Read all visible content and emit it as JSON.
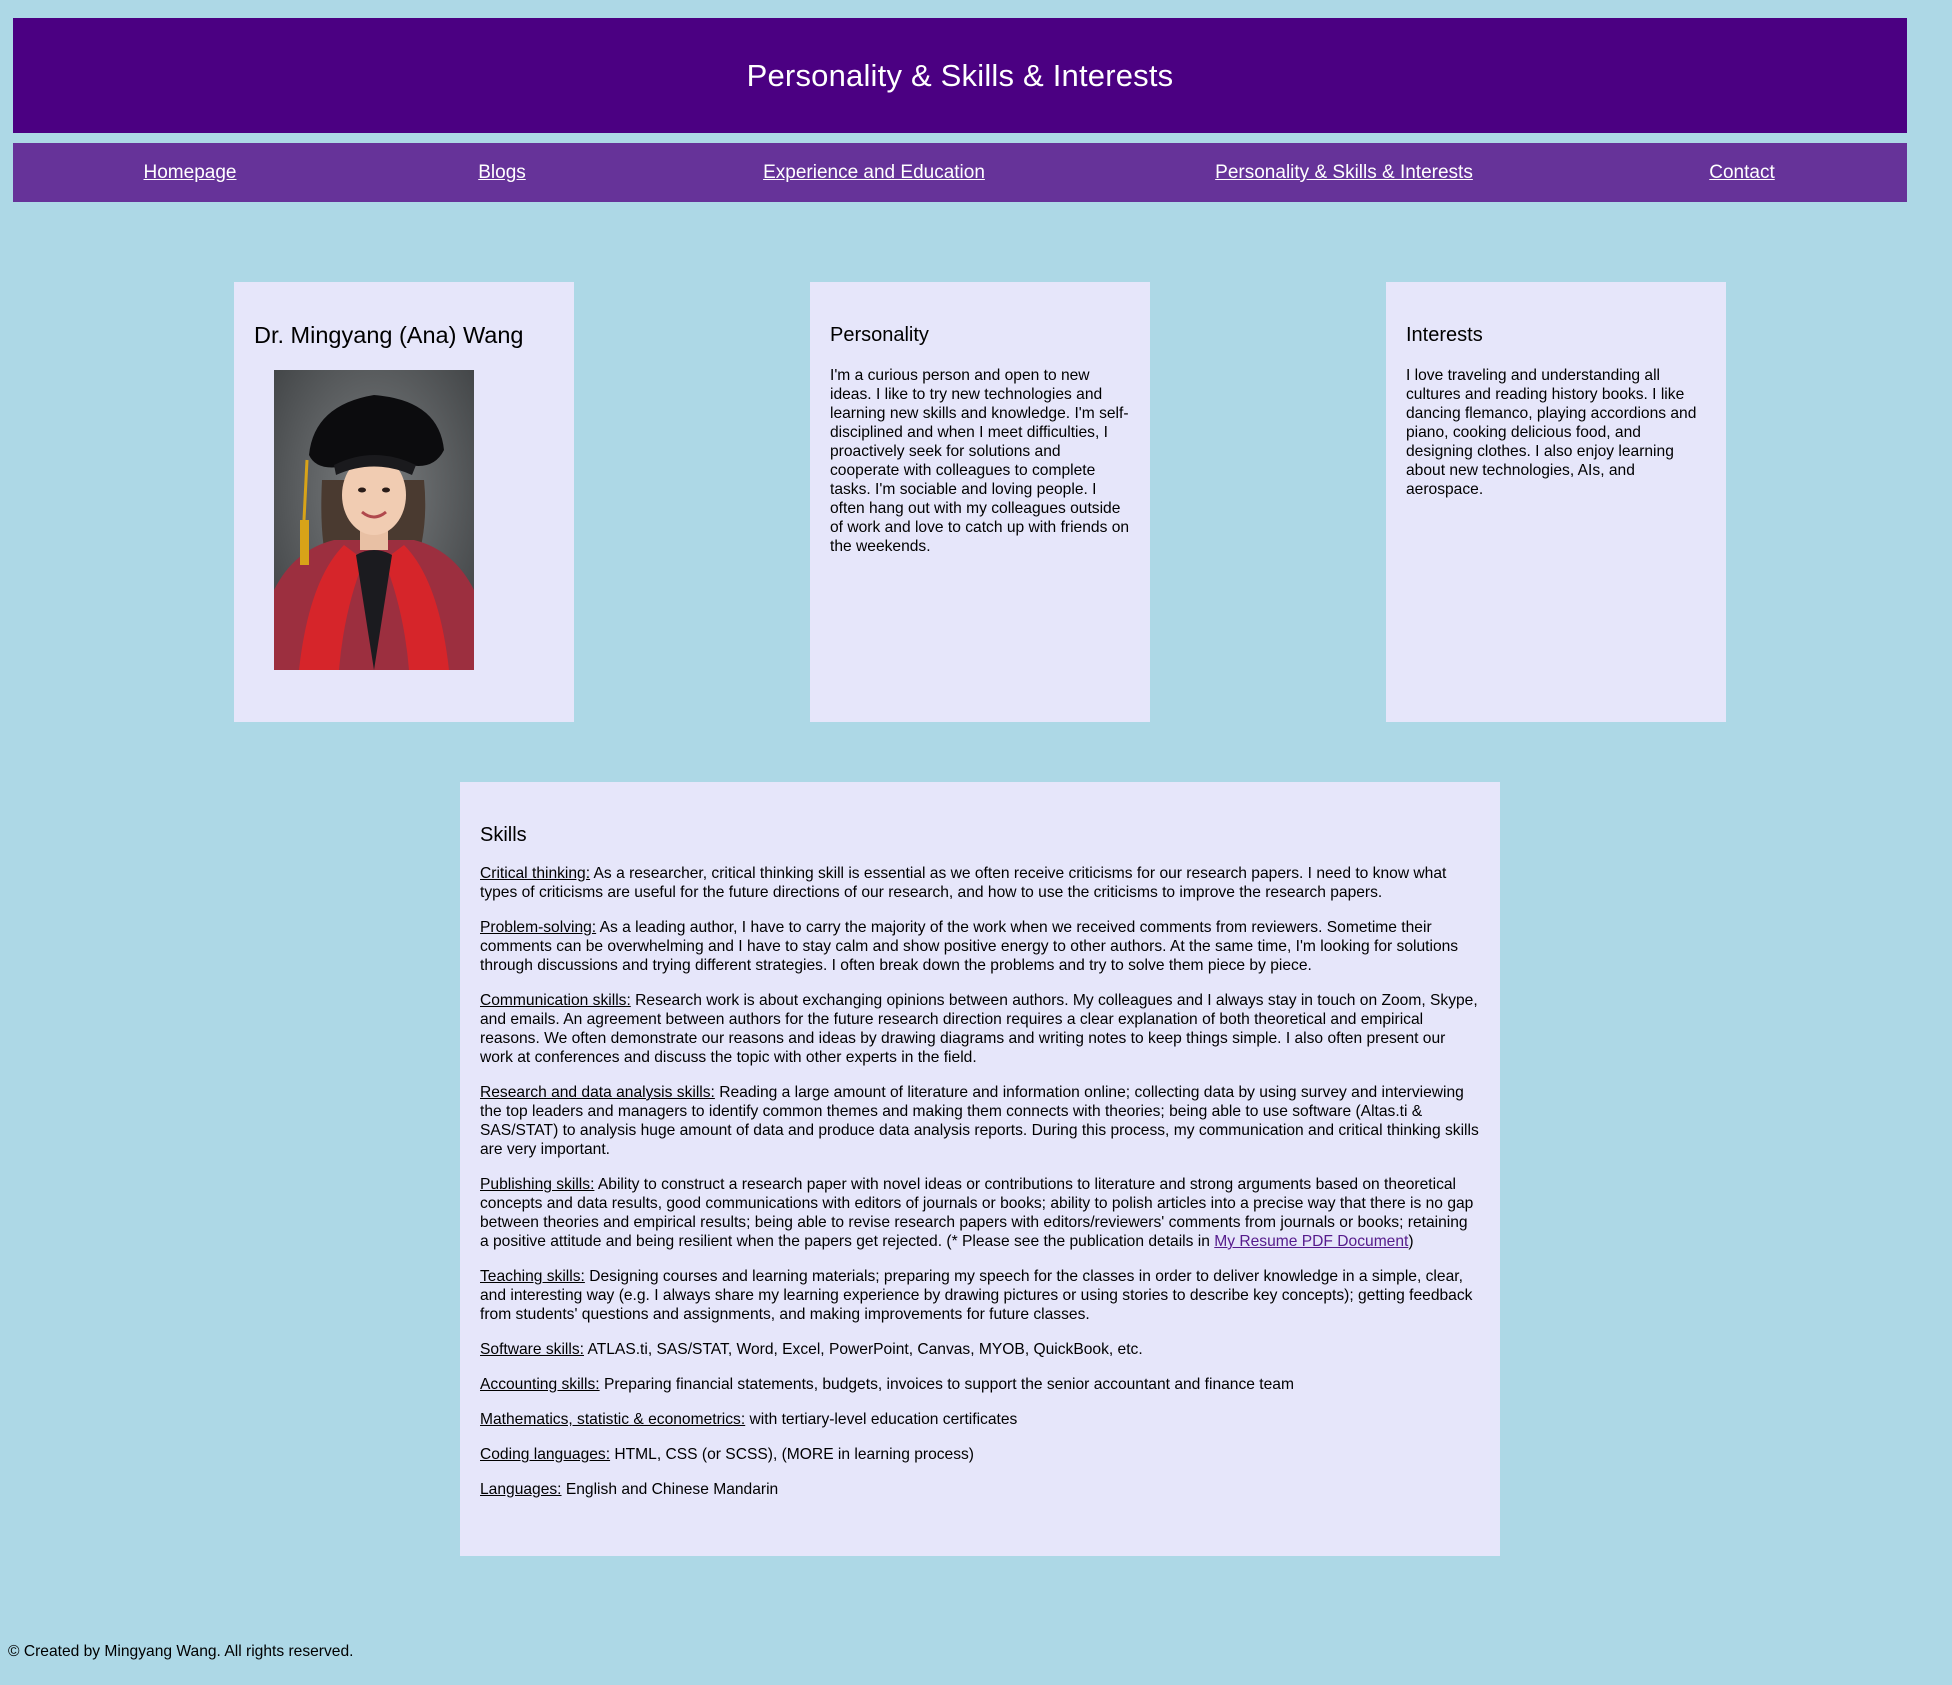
{
  "header": {
    "title": "Personality & Skills & Interests"
  },
  "nav": {
    "items": [
      {
        "label": "Homepage"
      },
      {
        "label": "Blogs"
      },
      {
        "label": "Experience and Education"
      },
      {
        "label": "Personality & Skills & Interests"
      },
      {
        "label": "Contact"
      }
    ]
  },
  "profile": {
    "name": "Dr. Mingyang (Ana) Wang"
  },
  "personality": {
    "title": "Personality",
    "text": "I'm a curious person and open to new ideas. I like to try new technologies and learning new skills and knowledge. I'm self-disciplined and when I meet difficulties, I proactively seek for solutions and cooperate with colleagues to complete tasks. I'm sociable and loving people. I often hang out with my colleagues outside of work and love to catch up with friends on the weekends."
  },
  "interests": {
    "title": "Interests",
    "text": "I love traveling and understanding all cultures and reading history books. I like dancing flemanco, playing accordions and piano, cooking delicious food, and designing clothes. I also enjoy learning about new technologies, AIs, and aerospace."
  },
  "skills": {
    "title": "Skills",
    "items": [
      {
        "label": "Critical thinking:",
        "text": " As a researcher, critical thinking skill is essential as we often receive criticisms for our research papers. I need to know what types of criticisms are useful for the future directions of our research, and how to use the criticisms to improve the research papers."
      },
      {
        "label": "Problem-solving:",
        "text": " As a leading author, I have to carry the majority of the work when we received comments from reviewers. Sometime their comments can be overwhelming and I have to stay calm and show positive energy to other authors. At the same time, I'm looking for solutions through discussions and trying different strategies. I often break down the problems and try to solve them piece by piece."
      },
      {
        "label": "Communication skills:",
        "text": " Research work is about exchanging opinions between authors. My colleagues and I always stay in touch on Zoom, Skype, and emails. An agreement between authors for the future research direction requires a clear explanation of both theoretical and empirical reasons. We often demonstrate our reasons and ideas by drawing diagrams and writing notes to keep things simple. I also often present our work at conferences and discuss the topic with other experts in the field."
      },
      {
        "label": "Research and data analysis skills:",
        "text": " Reading a large amount of literature and information online; collecting data by using survey and interviewing the top leaders and managers to identify common themes and making them connects with theories; being able to use software (Altas.ti & SAS/STAT) to analysis huge amount of data and produce data analysis reports. During this process, my communication and critical thinking skills are very important."
      },
      {
        "label": "Publishing skills:",
        "text": " Ability to construct a research paper with novel ideas or contributions to literature and strong arguments based on theoretical concepts and data results, good communications with editors of journals or books; ability to polish articles into a precise way that there is no gap between theories and empirical results; being able to revise research papers with editors/reviewers' comments from journals or books; retaining a positive attitude and being resilient when the papers get rejected. (* Please see the publication details in ",
        "link": "My Resume PDF Document",
        "after": ")"
      },
      {
        "label": "Teaching skills:",
        "text": " Designing courses and learning materials; preparing my speech for the classes in order to deliver knowledge in a simple, clear, and interesting way (e.g. I always share my learning experience by drawing pictures or using stories to describe key concepts); getting feedback from students' questions and assignments, and making improvements for future classes."
      },
      {
        "label": "Software skills:",
        "text": " ATLAS.ti, SAS/STAT, Word, Excel, PowerPoint, Canvas, MYOB, QuickBook, etc."
      },
      {
        "label": "Accounting skills:",
        "text": " Preparing financial statements, budgets, invoices to support the senior accountant and finance team"
      },
      {
        "label": "Mathematics, statistic & econometrics:",
        "text": " with tertiary-level education certificates"
      },
      {
        "label": "Coding languages:",
        "text": " HTML, CSS (or SCSS), (MORE in learning process)"
      },
      {
        "label": "Languages:",
        "text": " English and Chinese Mandarin"
      }
    ]
  },
  "footer": {
    "text": "© Created by Mingyang Wang. All rights reserved."
  },
  "colors": {
    "page_background": "#add8e6",
    "header_background": "#4b0082",
    "nav_background": "#663399",
    "card_background": "#e6e6fa",
    "link_visited": "#551a8b"
  }
}
